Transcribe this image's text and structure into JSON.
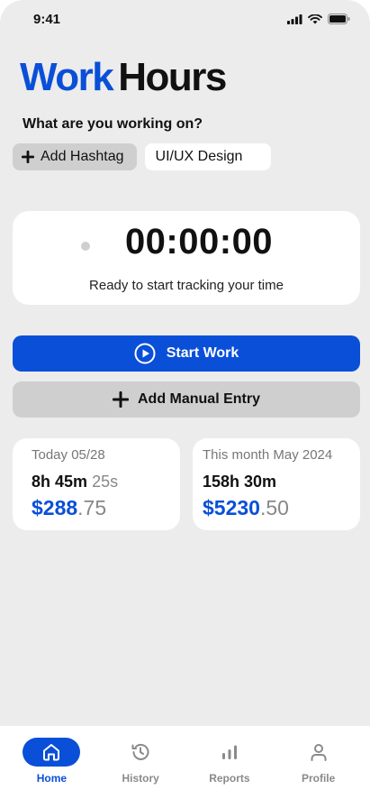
{
  "status_bar": {
    "time": "9:41"
  },
  "logo": {
    "work": "Work",
    "hours": "Hours"
  },
  "prompt": "What are you working on?",
  "hashtag": {
    "add_label": "Add Hashtag",
    "current_tag": "UI/UX Design"
  },
  "timer": {
    "value": "00:00:00",
    "subtitle": "Ready to start tracking your time"
  },
  "actions": {
    "start_label": "Start Work",
    "manual_label": "Add Manual Entry"
  },
  "stats": {
    "today": {
      "title": "Today 05/28",
      "hours_main": "8h 45m",
      "hours_extra": "25s",
      "money_main": "$288",
      "money_cents": ".75"
    },
    "month": {
      "title": "This month May 2024",
      "hours_main": "158h 30m",
      "money_main": "$5230",
      "money_cents": ".50"
    }
  },
  "nav": {
    "items": [
      {
        "label": "Home",
        "icon": "home-icon",
        "active": true
      },
      {
        "label": "History",
        "icon": "history-icon",
        "active": false
      },
      {
        "label": "Reports",
        "icon": "bar-chart-icon",
        "active": false
      },
      {
        "label": "Profile",
        "icon": "user-icon",
        "active": false
      }
    ]
  },
  "colors": {
    "brand": "#0a4fd8",
    "background": "#ececec",
    "chip": "#cfcfcf"
  }
}
